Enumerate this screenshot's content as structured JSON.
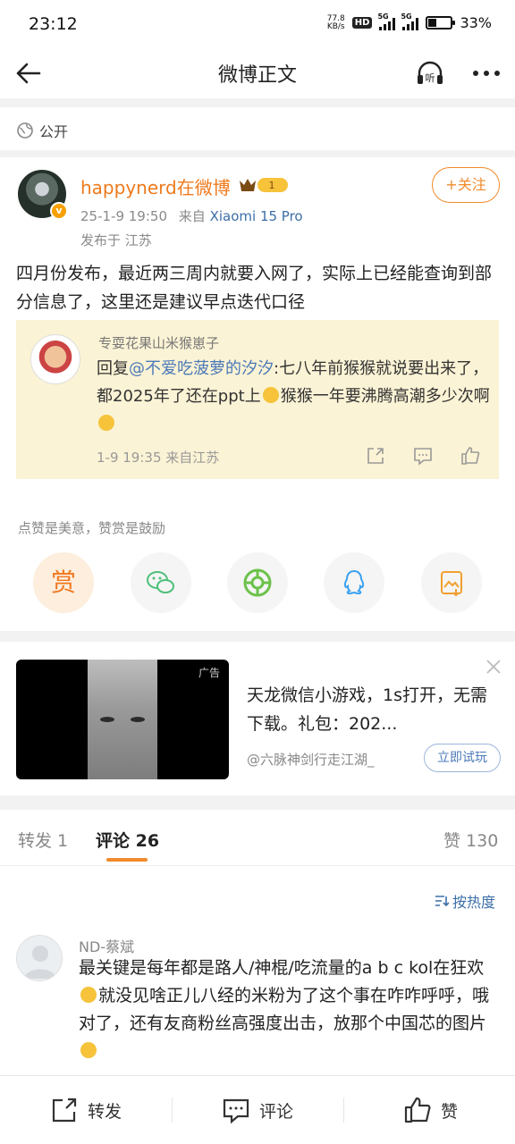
{
  "status_bar": {
    "time": "23:12",
    "net_speed_value": "77.8",
    "net_speed_unit": "KB/s",
    "hd": "HD",
    "sim1": "5G",
    "sim2": "5G",
    "battery_text": "33%",
    "battery_level": 0.33
  },
  "nav": {
    "title": "微博正文"
  },
  "visibility": {
    "label": "公开"
  },
  "post": {
    "author": "happynerd在微博",
    "member_level": "1",
    "follow_label": "+关注",
    "date": "25-1-9 19:50",
    "from_prefix": "来自",
    "source": "Xiaomi 15 Pro",
    "location": "发布于 江苏",
    "text": "四月份发布，最近两三周内就要入网了，实际上已经能查询到部分信息了，这里还是建议早点迭代口径"
  },
  "quoted": {
    "author": "专耍花果山米猴崽子",
    "reply_prefix": "回复",
    "mention": "@不爱吃菠萝的汐汐",
    "text_part1": ":七八年前猴猴就说要出来了，都2025年了还在ppt上",
    "text_part2": "猴猴一年要沸腾高潮多少次啊",
    "meta": "1-9 19:35 来自江苏"
  },
  "reward": {
    "hint": "点赞是美意，赞赏是鼓励",
    "reward_label": "赏"
  },
  "ad": {
    "tag": "广告",
    "title": "天龙微信小游戏，1s打开，无需下载。礼包：202...",
    "source": "@六脉神剑行走江湖_",
    "button": "立即试玩"
  },
  "tabs": {
    "repost": "转发 1",
    "comments": "评论 26",
    "likes": "赞 130"
  },
  "sort": {
    "label": "按热度"
  },
  "comment": {
    "author": "ND-蔡斌",
    "text_part1": "最关键是每年都是路人/神棍/吃流量的a b c kol在狂欢",
    "text_part2": "就没见啥正儿八经的米粉为了这个事在咋咋呼呼，哦对了，还有友商粉丝高强度出击，放那个中国芯的图片"
  },
  "bottom_bar": {
    "repost": "转发",
    "comment": "评论",
    "like": "赞"
  },
  "colors": {
    "accent": "#f08a2c",
    "link": "#3c6ea7",
    "quote_bg": "#fbf3d5"
  }
}
